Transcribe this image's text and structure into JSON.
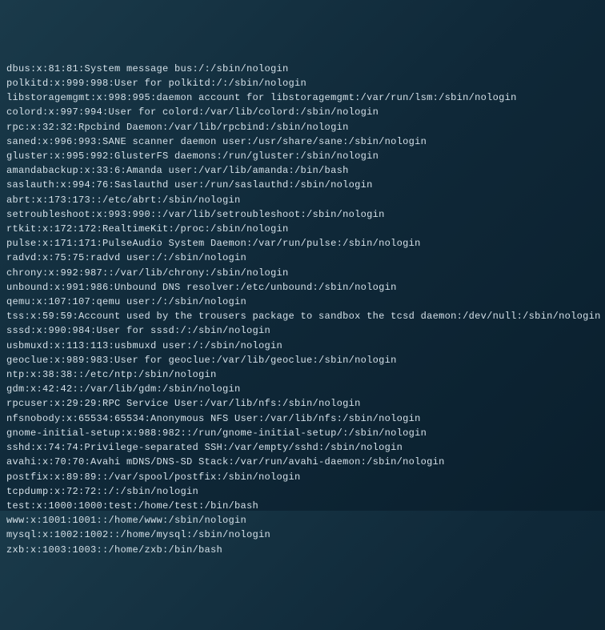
{
  "file": "/etc/passwd",
  "lines": [
    "dbus:x:81:81:System message bus:/:/sbin/nologin",
    "polkitd:x:999:998:User for polkitd:/:/sbin/nologin",
    "libstoragemgmt:x:998:995:daemon account for libstoragemgmt:/var/run/lsm:/sbin/nologin",
    "colord:x:997:994:User for colord:/var/lib/colord:/sbin/nologin",
    "rpc:x:32:32:Rpcbind Daemon:/var/lib/rpcbind:/sbin/nologin",
    "saned:x:996:993:SANE scanner daemon user:/usr/share/sane:/sbin/nologin",
    "gluster:x:995:992:GlusterFS daemons:/run/gluster:/sbin/nologin",
    "amandabackup:x:33:6:Amanda user:/var/lib/amanda:/bin/bash",
    "saslauth:x:994:76:Saslauthd user:/run/saslauthd:/sbin/nologin",
    "abrt:x:173:173::/etc/abrt:/sbin/nologin",
    "setroubleshoot:x:993:990::/var/lib/setroubleshoot:/sbin/nologin",
    "rtkit:x:172:172:RealtimeKit:/proc:/sbin/nologin",
    "pulse:x:171:171:PulseAudio System Daemon:/var/run/pulse:/sbin/nologin",
    "radvd:x:75:75:radvd user:/:/sbin/nologin",
    "chrony:x:992:987::/var/lib/chrony:/sbin/nologin",
    "unbound:x:991:986:Unbound DNS resolver:/etc/unbound:/sbin/nologin",
    "qemu:x:107:107:qemu user:/:/sbin/nologin",
    "tss:x:59:59:Account used by the trousers package to sandbox the tcsd daemon:/dev/null:/sbin/nologin",
    "sssd:x:990:984:User for sssd:/:/sbin/nologin",
    "usbmuxd:x:113:113:usbmuxd user:/:/sbin/nologin",
    "geoclue:x:989:983:User for geoclue:/var/lib/geoclue:/sbin/nologin",
    "ntp:x:38:38::/etc/ntp:/sbin/nologin",
    "gdm:x:42:42::/var/lib/gdm:/sbin/nologin",
    "rpcuser:x:29:29:RPC Service User:/var/lib/nfs:/sbin/nologin",
    "nfsnobody:x:65534:65534:Anonymous NFS User:/var/lib/nfs:/sbin/nologin",
    "gnome-initial-setup:x:988:982::/run/gnome-initial-setup/:/sbin/nologin",
    "sshd:x:74:74:Privilege-separated SSH:/var/empty/sshd:/sbin/nologin",
    "avahi:x:70:70:Avahi mDNS/DNS-SD Stack:/var/run/avahi-daemon:/sbin/nologin",
    "postfix:x:89:89::/var/spool/postfix:/sbin/nologin",
    "tcpdump:x:72:72::/:/sbin/nologin",
    "test:x:1000:1000:test:/home/test:/bin/bash",
    "www:x:1001:1001::/home/www:/sbin/nologin",
    "mysql:x:1002:1002::/home/mysql:/sbin/nologin",
    "zxb:x:1003:1003::/home/zxb:/bin/bash"
  ]
}
